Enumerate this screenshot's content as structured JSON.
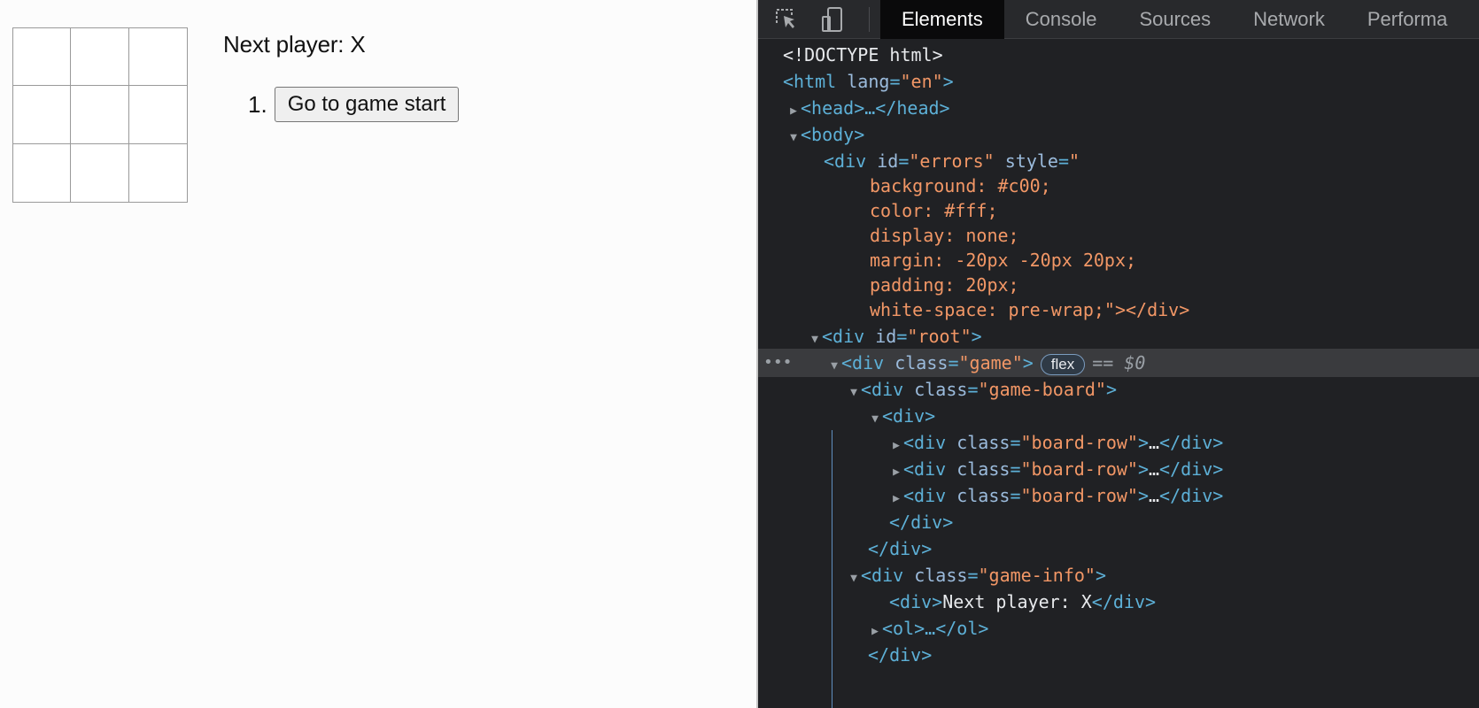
{
  "app": {
    "status": "Next player: X",
    "moves": [
      {
        "number": "1.",
        "label": "Go to game start"
      }
    ]
  },
  "devtools": {
    "tabs": [
      "Elements",
      "Console",
      "Sources",
      "Network",
      "Performa"
    ],
    "active_tab": "Elements",
    "icons": [
      "inspect-element-icon",
      "device-toolbar-icon"
    ],
    "dom": {
      "doctype": "<!DOCTYPE html>",
      "html_open": "<html",
      "html_attr": "lang",
      "html_val": "\"en\"",
      "head_collapsed": "<head>…</head>",
      "body_open": "<body>",
      "errors_div": "<div",
      "errors_id_attr": "id",
      "errors_id_val": "\"errors\"",
      "errors_style_attr": "style",
      "errors_style_open": "\"",
      "css_lines": [
        "background: #c00;",
        "color: #fff;",
        "display: none;",
        "margin: -20px -20px 20px;",
        "padding: 20px;",
        "white-space: pre-wrap;"
      ],
      "errors_close": "\"></div>",
      "root_div": "<div",
      "root_attr": "id",
      "root_val": "\"root\"",
      "game_div": "<div",
      "game_attr": "class",
      "game_val": "\"game\"",
      "flex_badge": "flex",
      "selected_marker": "== $0",
      "gameboard_attr": "class",
      "gameboard_val": "\"game-board\"",
      "inner_div": "<div>",
      "board_row_attr": "class",
      "board_row_val": "\"board-row\"",
      "collapsed": "…",
      "div_close": "</div>",
      "gameinfo_attr": "class",
      "gameinfo_val": "\"game-info\"",
      "nextplayer_open": "<div>",
      "nextplayer_text": "Next player: X",
      "nextplayer_close": "</div>",
      "ol_collapsed": "<ol>…</ol>"
    }
  },
  "colors": {
    "devtools_bg": "#202124",
    "tag": "#5db0d7",
    "attr_name": "#9bbbdc",
    "attr_value": "#f29766",
    "selected_row": "#3a3b3e"
  }
}
